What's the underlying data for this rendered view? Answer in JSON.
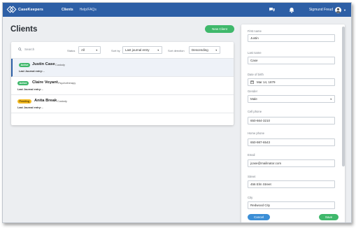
{
  "nav": {
    "brand": "CaseKeepers",
    "links": [
      "Clients",
      "Help/FAQs"
    ],
    "user_name": "Sigmund Freud",
    "icons": [
      "chat-icon",
      "bell-icon",
      "user-avatar-icon",
      "caret-down-icon"
    ]
  },
  "page": {
    "title": "Clients",
    "new_client_label": "New Client"
  },
  "filters": {
    "search_placeholder": "Search",
    "status_label": "Status",
    "status_value": "All",
    "sortby_label": "Sort by",
    "sortby_value": "Last journal entry",
    "sortdir_label": "Sort direction",
    "sortdir_value": "Descending"
  },
  "clients": [
    {
      "status": "Active",
      "name": "Justin Case",
      "type": "Custody",
      "journal": "Last Journal entry: -",
      "selected": true
    },
    {
      "status": "Active",
      "name": "Claire Voyant",
      "type": "Psychotherapy",
      "journal": "Last Journal entry: -",
      "selected": false
    },
    {
      "status": "Pending",
      "name": "Anita Break",
      "type": "Custody",
      "journal": "Last Journal entry: -",
      "selected": false
    }
  ],
  "form": {
    "first_name_label": "First name",
    "first_name_value": "Justin",
    "last_name_label": "Last name",
    "last_name_value": "Case",
    "dob_label": "Date of birth",
    "dob_value": "Mar 14, 1879",
    "gender_label": "Gender",
    "gender_value": "Male",
    "cell_label": "Cell phone",
    "cell_value": "650-664-3210",
    "home_label": "Home phone",
    "home_value": "650-987-6543",
    "email_label": "Email",
    "email_value": "jcase@mailinator.com",
    "street_label": "Street",
    "street_value": "456 Elm Street",
    "city_label": "City",
    "city_value": "Redwood City",
    "cancel_label": "Cancel",
    "save_label": "Save"
  },
  "colors": {
    "nav": "#2d5fa6",
    "green": "#3fb86b",
    "pending": "#f2b81f",
    "cancel": "#3b8ed6"
  }
}
